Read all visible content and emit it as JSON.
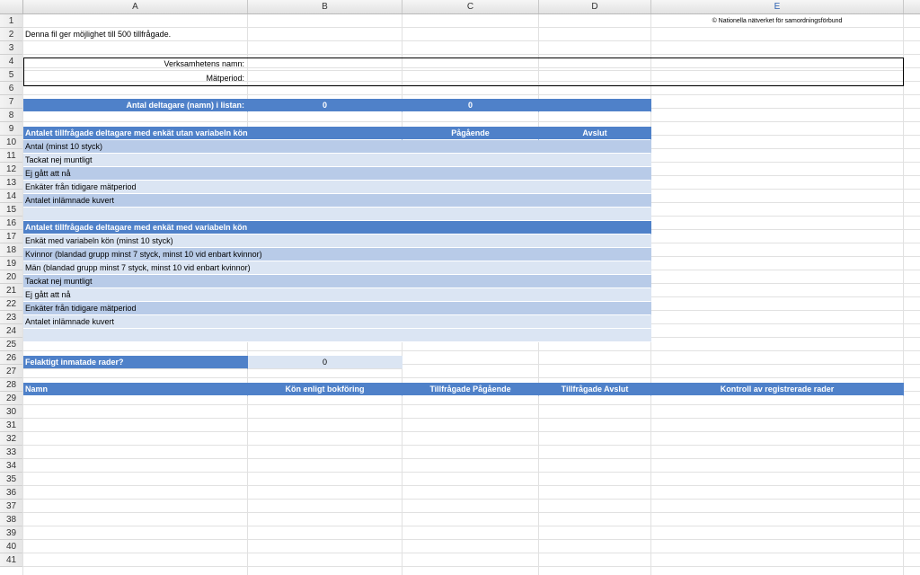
{
  "columns": [
    "A",
    "B",
    "C",
    "D",
    "E"
  ],
  "selected_column": "E",
  "row_numbers": [
    "1",
    "2",
    "3",
    "4",
    "5",
    "6",
    "7",
    "8",
    "9",
    "10",
    "11",
    "12",
    "13",
    "14",
    "15",
    "16",
    "17",
    "18",
    "19",
    "20",
    "21",
    "22",
    "23",
    "24",
    "25",
    "26",
    "27",
    "28",
    "29",
    "30",
    "31",
    "32",
    "33",
    "34",
    "35",
    "36",
    "37",
    "38",
    "39",
    "40",
    "41"
  ],
  "copyright": "© Nationella nätverket för samordningsförbund",
  "intro": "Denna fil ger möjlighet till 500 tillfrågade.",
  "org_name_label": "Verksamhetens namn:",
  "period_label": "Mätperiod:",
  "participants": {
    "label": "Antal deltagare (namn) i listan:",
    "value_b": "0",
    "value_c": "0"
  },
  "section1": {
    "title": "Antalet tillfrågade deltagare med enkät utan variabeln kön",
    "col_ongoing": "Pågående",
    "col_ended": "Avslut",
    "rows": [
      "Antal (minst 10 styck)",
      "Tackat nej muntligt",
      "Ej gått att nå",
      "Enkäter från tidigare mätperiod",
      "Antalet inlämnade kuvert"
    ]
  },
  "section2": {
    "title": "Antalet tillfrågade deltagare med enkät med variabeln kön",
    "rows": [
      "Enkät med variabeln kön (minst 10 styck)",
      "Kvinnor  (blandad grupp minst 7 styck, minst 10 vid enbart kvinnor)",
      "Män (blandad grupp minst 7 styck, minst 10 vid enbart kvinnor)",
      "Tackat nej muntligt",
      "Ej gått att nå",
      "Enkäter från tidigare mätperiod",
      "Antalet inlämnade kuvert"
    ]
  },
  "errors": {
    "label": "Felaktigt inmatade rader?",
    "value": "0"
  },
  "table_header": {
    "name": "Namn",
    "gender": "Kön enligt bokföring",
    "asked_ongoing": "Tillfrågade Pågående",
    "asked_ended": "Tillfrågade Avslut",
    "check": "Kontroll av registrerade rader"
  }
}
